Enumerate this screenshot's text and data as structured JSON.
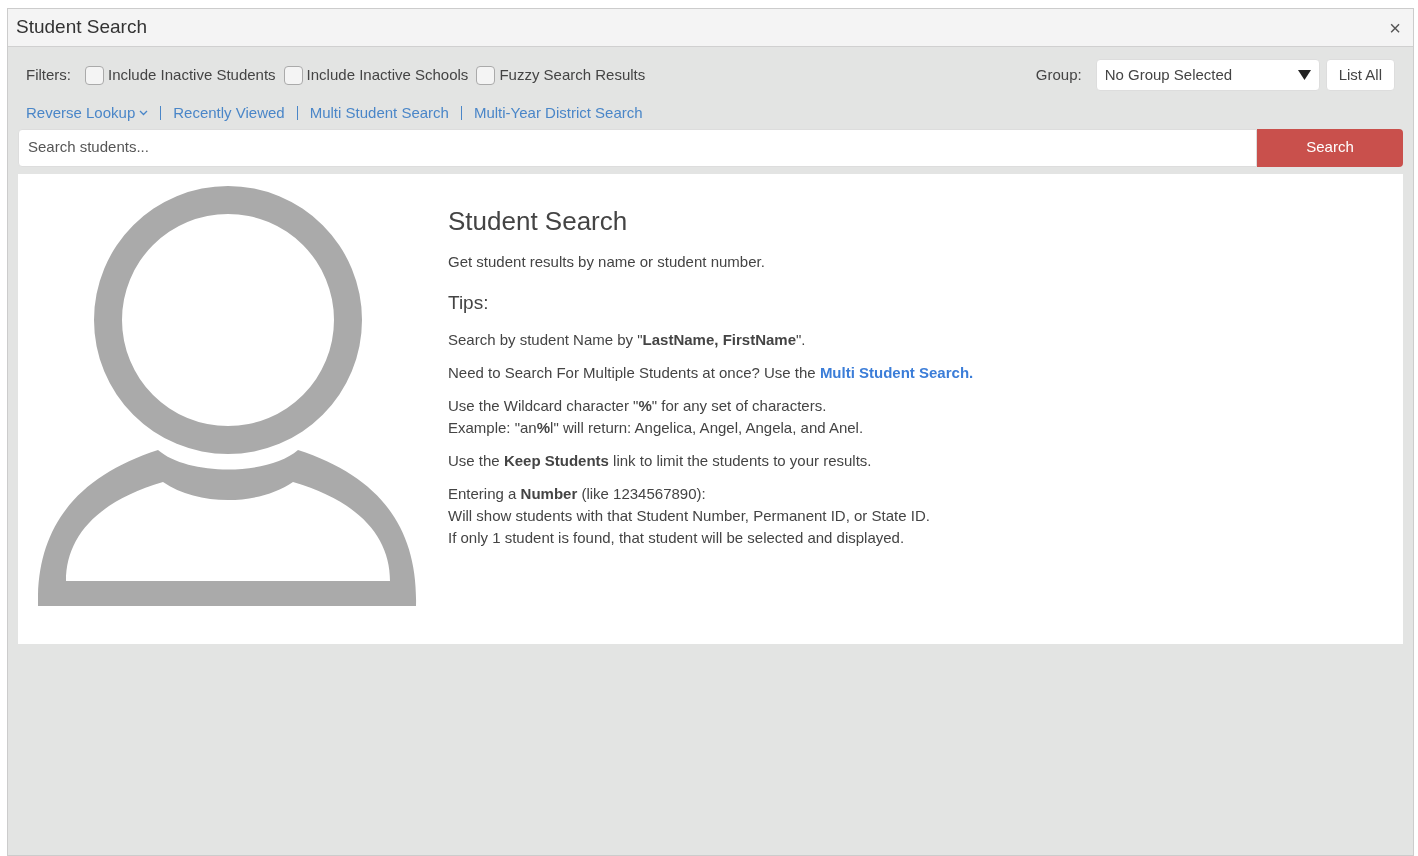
{
  "window": {
    "title": "Student Search",
    "close": "×"
  },
  "filters": {
    "label": "Filters:",
    "options": [
      {
        "label": "Include Inactive Students",
        "checked": false
      },
      {
        "label": "Include Inactive Schools",
        "checked": false
      },
      {
        "label": "Fuzzy Search Results",
        "checked": false
      }
    ]
  },
  "group": {
    "label": "Group:",
    "value": "No Group Selected",
    "button": "List All"
  },
  "links": [
    {
      "label": "Reverse Lookup",
      "kind": "dropdown"
    },
    {
      "label": "Recently Viewed",
      "kind": "link"
    },
    {
      "label": "Multi Student Search",
      "kind": "link"
    },
    {
      "label": "Multi-Year District Search",
      "kind": "link"
    }
  ],
  "search": {
    "placeholder": "Search students...",
    "button": "Search"
  },
  "help": {
    "title": "Student Search",
    "subtitle": "Get student results by name or student number.",
    "tips_title": "Tips:",
    "tips": [
      {
        "lines": [
          "Search by student Name by \"**LastName, FirstName**\"."
        ]
      },
      {
        "lines": [
          "Need to Search For Multiple Students at once? Use the "
        ],
        "link": "Multi Student Search."
      },
      {
        "lines": [
          "Use the Wildcard character \"**%**\" for any set of characters.",
          "Example: \"an**%**l\" will return: Angelica, Angel, Angela, and Anel."
        ]
      },
      {
        "lines": [
          "Use the **Keep Students** link to limit the students to your results."
        ]
      },
      {
        "lines": [
          "Entering a **Number** (like 1234567890):",
          "Will show students with that Student Number, Permanent ID, or State ID.",
          "If only 1 student is found, that student will be selected and displayed."
        ]
      }
    ]
  }
}
